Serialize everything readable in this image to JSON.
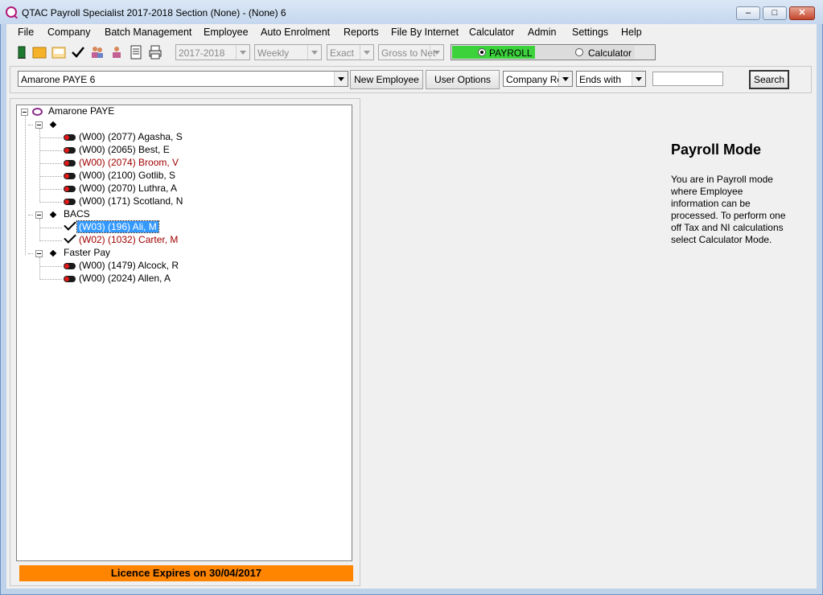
{
  "window": {
    "title": "QTAC Payroll Specialist 2017-2018  Section (None) - (None) 6",
    "minimize_glyph": "–",
    "maximize_glyph": "□",
    "close_glyph": "✕"
  },
  "menu": [
    "File",
    "Company",
    "Batch Management",
    "Employee",
    "Auto Enrolment",
    "Reports",
    "File By Internet",
    "Calculator",
    "Admin",
    "Settings",
    "Help"
  ],
  "toolbar": {
    "icons": [
      "exit-door-icon",
      "folder-icon",
      "open-folder-icon",
      "check-icon",
      "employees-icon",
      "employee-icon",
      "report-icon",
      "print-icon"
    ],
    "tax_year": "2017-2018",
    "pay_frequency": "Weekly",
    "calc_type": "Exact",
    "calc_direction": "Gross to Net",
    "mode_payroll": "PAYROLL",
    "mode_calculator": "Calculator",
    "mode_selected": "PAYROLL"
  },
  "search": {
    "company": "Amarone PAYE 6",
    "new_employee_label": "New Employee",
    "user_options_label": "User Options",
    "field": "Company Ref",
    "match": "Ends with",
    "query": "",
    "search_label": "Search"
  },
  "tree": {
    "root": "Amarone PAYE",
    "groups": [
      {
        "name": "",
        "employees": [
          {
            "label": "(W00) (2077) Agasha, S",
            "status": "pending",
            "red": false
          },
          {
            "label": "(W00) (2065) Best, E",
            "status": "pending",
            "red": false
          },
          {
            "label": "(W00) (2074) Broom, V",
            "status": "pending",
            "red": true
          },
          {
            "label": "(W00) (2100) Gotlib, S",
            "status": "pending",
            "red": false
          },
          {
            "label": "(W00) (2070) Luthra, A",
            "status": "pending",
            "red": false
          },
          {
            "label": "(W00) (171) Scotland, N",
            "status": "pending",
            "red": false
          }
        ]
      },
      {
        "name": "BACS",
        "employees": [
          {
            "label": "(W03) (196) Ali, M",
            "status": "done",
            "red": false,
            "selected": true
          },
          {
            "label": "(W02) (1032) Carter, M",
            "status": "done",
            "red": true
          }
        ]
      },
      {
        "name": "Faster Pay",
        "employees": [
          {
            "label": "(W00) (1479) Alcock, R",
            "status": "pending",
            "red": false
          },
          {
            "label": "(W00) (2024) Allen, A",
            "status": "pending",
            "red": false
          }
        ]
      }
    ]
  },
  "licence": "Licence Expires on 30/04/2017",
  "info": {
    "title": "Payroll Mode",
    "text": "You are in Payroll mode where Employee information can be processed. To perform one off Tax and NI calculations select Calculator Mode."
  },
  "colors": {
    "payroll_mode": "#3cd23c",
    "licence_bar": "#ff8400",
    "selection": "#3399ff",
    "red_text": "#a00000"
  }
}
